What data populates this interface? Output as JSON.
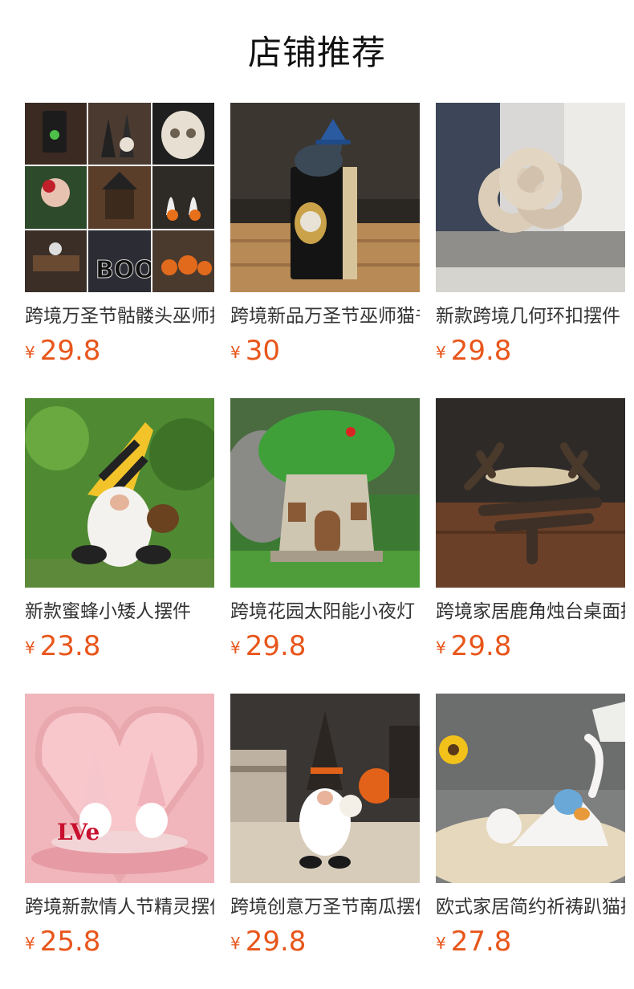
{
  "page": {
    "title": "店铺推荐"
  },
  "theme": {
    "price_color": "#e8561b"
  },
  "products": [
    {
      "name": "跨境万圣节骷髅头巫师摆件",
      "currency": "¥",
      "price": "29.8",
      "image": "halloween-collage-image"
    },
    {
      "name": "跨境新品万圣节巫师猫书本摆件",
      "currency": "¥",
      "price": "30",
      "image": "witch-cat-book-image"
    },
    {
      "name": "新款跨境几何环扣摆件",
      "currency": "¥",
      "price": "29.8",
      "image": "knot-sculpture-image"
    },
    {
      "name": "新款蜜蜂小矮人摆件",
      "currency": "¥",
      "price": "23.8",
      "image": "bee-gnome-image"
    },
    {
      "name": "跨境花园太阳能小夜灯",
      "currency": "¥",
      "price": "29.8",
      "image": "mushroom-house-image"
    },
    {
      "name": "跨境家居鹿角烛台桌面摆件",
      "currency": "¥",
      "price": "29.8",
      "image": "antler-candle-holder-image"
    },
    {
      "name": "跨境新款情人节精灵摆件",
      "currency": "¥",
      "price": "25.8",
      "image": "valentine-gnomes-image"
    },
    {
      "name": "跨境创意万圣节南瓜摆件",
      "currency": "¥",
      "price": "29.8",
      "image": "pumpkin-gnome-image"
    },
    {
      "name": "欧式家居简约祈祷趴猫摆件",
      "currency": "¥",
      "price": "27.8",
      "image": "stretching-cat-image"
    }
  ]
}
